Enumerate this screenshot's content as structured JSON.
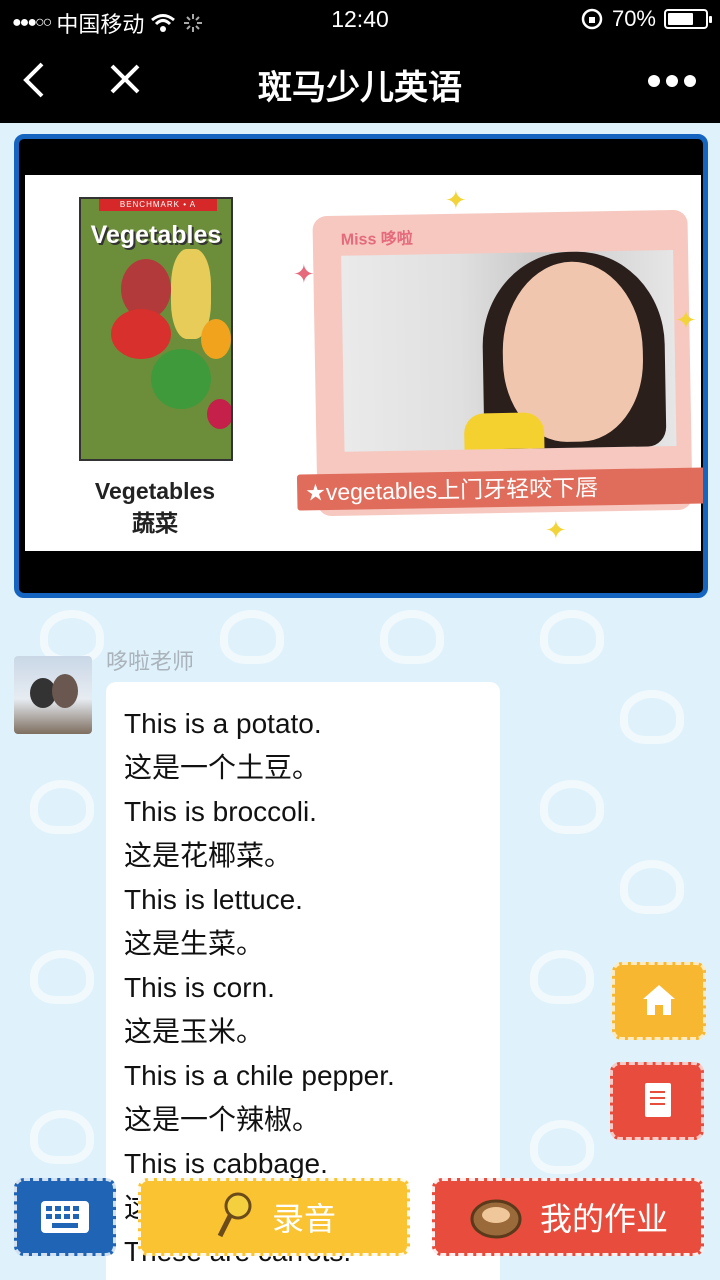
{
  "status_bar": {
    "carrier": "中国移动",
    "time": "12:40",
    "battery": "70%",
    "battery_level": 0.7
  },
  "nav": {
    "title": "斑马少儿英语"
  },
  "video": {
    "book_band": "BENCHMARK • A",
    "book_cover_title": "Vegetables",
    "book_title_en": "Vegetables",
    "book_title_cn": "蔬菜",
    "teacher_badge": "Miss 哆啦",
    "caption": "★vegetables上门牙轻咬下唇"
  },
  "message": {
    "sender": "哆啦老师",
    "lines": [
      "This is a potato.",
      "这是一个土豆。",
      "This is broccoli.",
      "这是花椰菜。",
      "This is lettuce.",
      "这是生菜。",
      "This is corn.",
      "这是玉米。",
      "This is a chile pepper.",
      "这是一个辣椒。",
      "This is cabbage.",
      "这是卷心菜。",
      "These are carrots."
    ]
  },
  "bottom": {
    "record_label": "录音",
    "homework_label": "我的作业"
  },
  "colors": {
    "accent_blue": "#1565c0",
    "button_yellow": "#f9c332",
    "button_red": "#e74c3c"
  }
}
